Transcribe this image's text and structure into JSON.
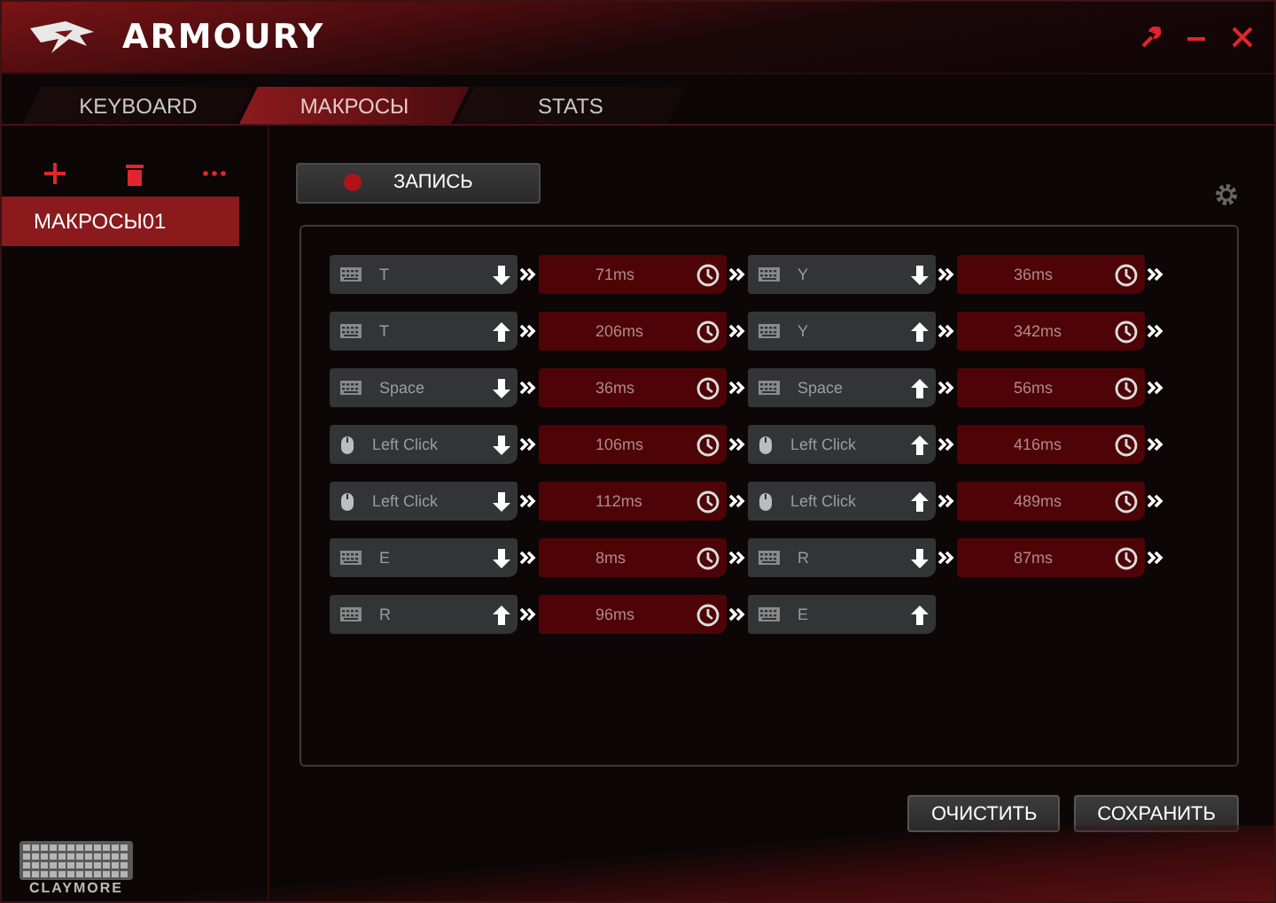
{
  "app": {
    "title": "ARMOURY",
    "footer_label": "CLAYMORE"
  },
  "tabs": [
    {
      "label": "KEYBOARD",
      "selected": false
    },
    {
      "label": "МАКРОСЫ",
      "selected": true
    },
    {
      "label": "STATS",
      "selected": false
    }
  ],
  "sidebar": {
    "items": [
      {
        "label": "МАКРОСЫ01",
        "selected": true
      }
    ]
  },
  "record_button": {
    "label": "ЗАПИСЬ"
  },
  "steps": [
    {
      "kind": "key",
      "label": "T",
      "up": false
    },
    {
      "kind": "delay",
      "label": "71ms"
    },
    {
      "kind": "key",
      "label": "Y",
      "up": false
    },
    {
      "kind": "delay",
      "label": "36ms"
    },
    {
      "kind": "key",
      "label": "T",
      "up": true
    },
    {
      "kind": "delay",
      "label": "206ms"
    },
    {
      "kind": "key",
      "label": "Y",
      "up": true
    },
    {
      "kind": "delay",
      "label": "342ms"
    },
    {
      "kind": "key",
      "label": "Space",
      "up": false
    },
    {
      "kind": "delay",
      "label": "36ms"
    },
    {
      "kind": "key",
      "label": "Space",
      "up": true
    },
    {
      "kind": "delay",
      "label": "56ms"
    },
    {
      "kind": "mouse",
      "label": "Left Click",
      "up": false
    },
    {
      "kind": "delay",
      "label": "106ms"
    },
    {
      "kind": "mouse",
      "label": "Left Click",
      "up": true
    },
    {
      "kind": "delay",
      "label": "416ms"
    },
    {
      "kind": "mouse",
      "label": "Left Click",
      "up": false
    },
    {
      "kind": "delay",
      "label": "112ms"
    },
    {
      "kind": "mouse",
      "label": "Left Click",
      "up": true
    },
    {
      "kind": "delay",
      "label": "489ms"
    },
    {
      "kind": "key",
      "label": "E",
      "up": false
    },
    {
      "kind": "delay",
      "label": "8ms"
    },
    {
      "kind": "key",
      "label": "R",
      "up": false
    },
    {
      "kind": "delay",
      "label": "87ms"
    },
    {
      "kind": "key",
      "label": "R",
      "up": true
    },
    {
      "kind": "delay",
      "label": "96ms"
    },
    {
      "kind": "key",
      "label": "E",
      "up": true
    }
  ],
  "buttons": [
    "ОЧИСТИТЬ",
    "СОХРАНИТЬ"
  ]
}
